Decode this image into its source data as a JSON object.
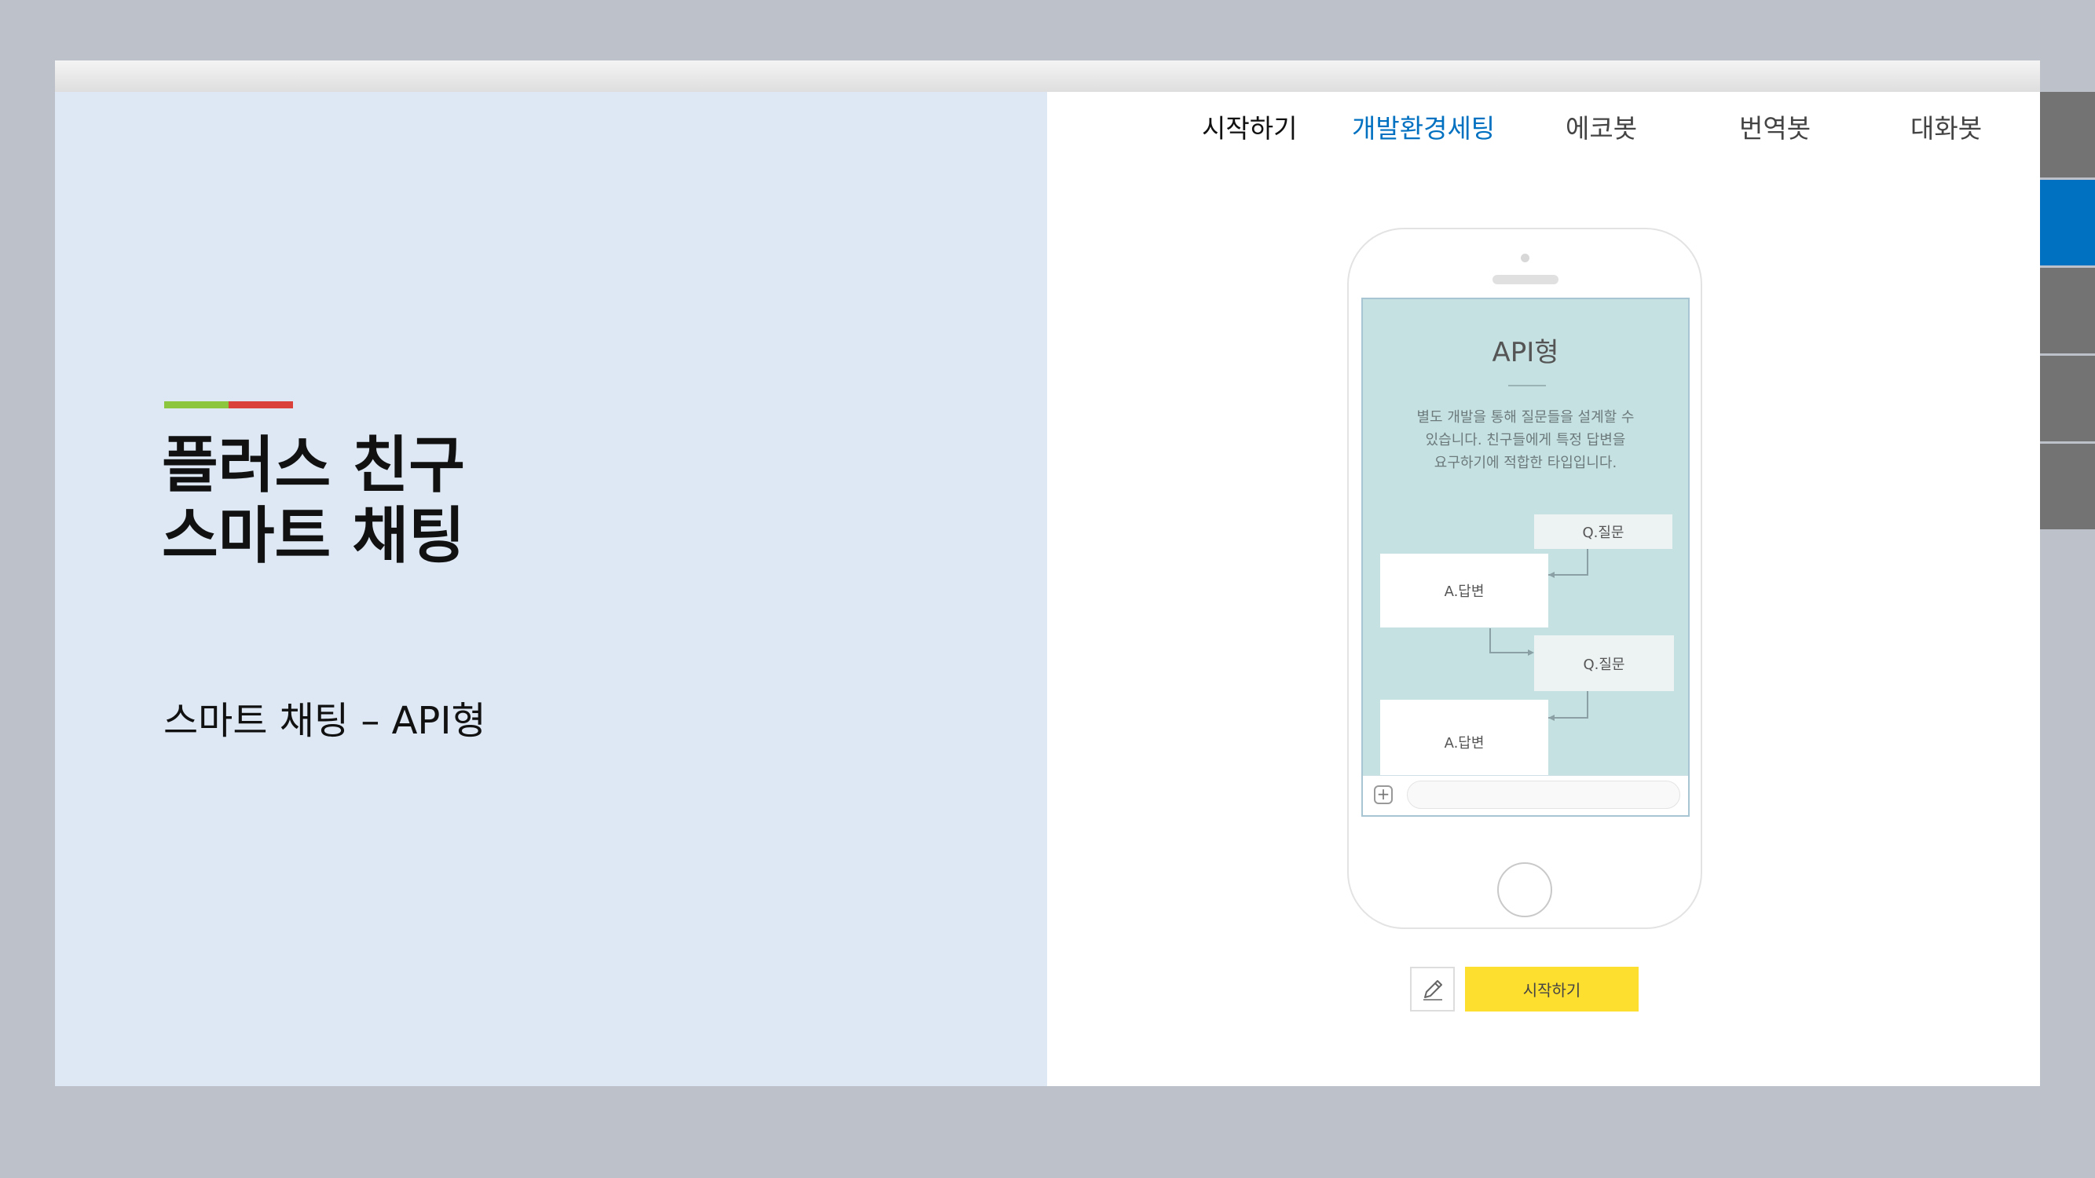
{
  "slide": {
    "title_line1": "플러스 친구",
    "title_line2": "스마트 채팅",
    "subtitle": "스마트 채팅 – API형",
    "accent_colors": [
      "#8cc63f",
      "#d9413a"
    ],
    "panel_color": "#dde8f4"
  },
  "nav": {
    "items": [
      {
        "label": "시작하기"
      },
      {
        "label": "개발환경세팅",
        "active": true
      },
      {
        "label": "에코봇"
      },
      {
        "label": "번역봇"
      },
      {
        "label": "대화봇"
      }
    ],
    "active_color": "#0070c0"
  },
  "phone": {
    "screen_title": "API형",
    "desc_line1": "별도 개발을 통해 질문들을 설계할 수",
    "desc_line2": "있습니다. 친구들에게 특정 답변을",
    "desc_line3": "요구하기에 적합한 타입입니다.",
    "bubbles": {
      "q1": "Q.질문",
      "a1": "A.답변",
      "q2": "Q.질문",
      "a2": "A.답변"
    }
  },
  "actions": {
    "start_label": "시작하기",
    "start_color": "#fddf2f",
    "edit_icon": "pencil-icon"
  },
  "side_tabs": {
    "count": 5,
    "active_index": 1
  }
}
